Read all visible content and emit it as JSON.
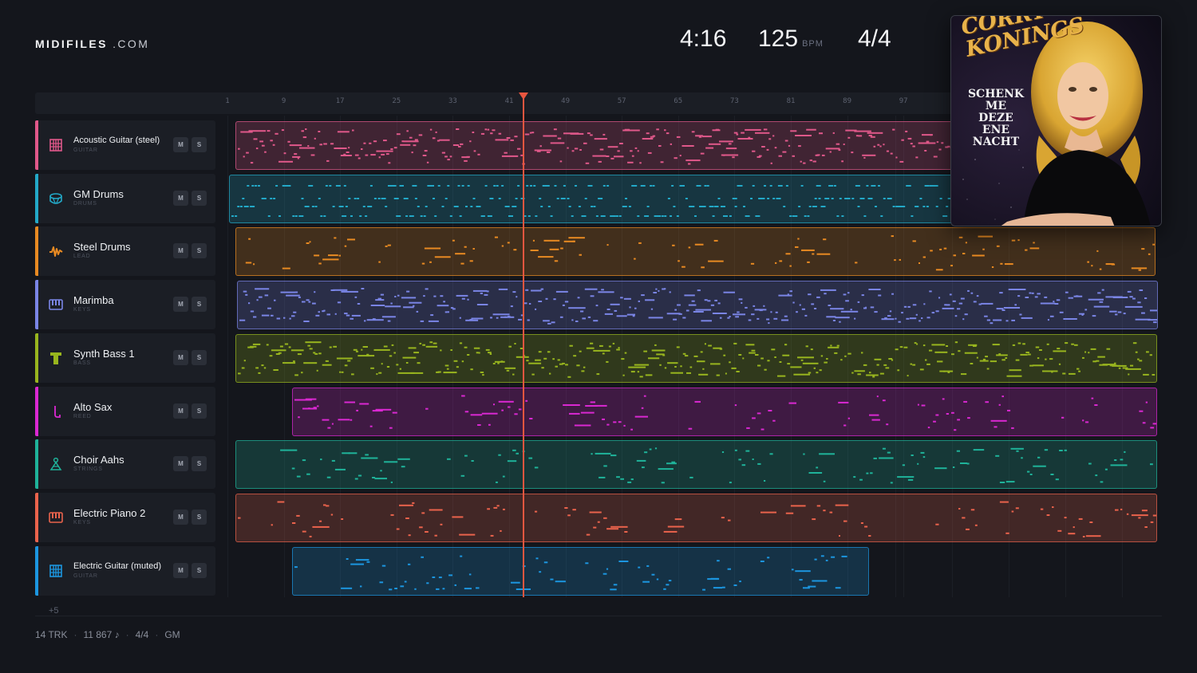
{
  "brand": {
    "name_bold": "MIDIFILES",
    "name_suffix": ".COM"
  },
  "stats": {
    "duration": "4:16",
    "tempo": "125",
    "tempo_unit": "BPM",
    "time_signature": "4/4"
  },
  "ruler": {
    "bars": [
      "1",
      "9",
      "17",
      "25",
      "33",
      "41",
      "49",
      "57",
      "65",
      "73",
      "81",
      "89",
      "97"
    ]
  },
  "playhead": {
    "bar": "41"
  },
  "album": {
    "artist_line1": "CORRY",
    "artist_line2": "KONINGS",
    "title_line1": "SCHENK ME",
    "title_line2": "DEZE",
    "title_line3": "ENE NACHT"
  },
  "tracks": [
    {
      "name": "Acoustic Guitar (steel)",
      "category": "GUITAR",
      "color": "#e0588a",
      "icon": "guitar-icon",
      "mute": "M",
      "solo": "S"
    },
    {
      "name": "GM Drums",
      "category": "DRUMS",
      "color": "#23a9c8",
      "icon": "drum-icon",
      "mute": "M",
      "solo": "S"
    },
    {
      "name": "Steel Drums",
      "category": "LEAD",
      "color": "#e88a22",
      "icon": "wave-icon",
      "mute": "M",
      "solo": "S"
    },
    {
      "name": "Marimba",
      "category": "KEYS",
      "color": "#7a85e6",
      "icon": "keys-icon",
      "mute": "M",
      "solo": "S"
    },
    {
      "name": "Synth Bass 1",
      "category": "BASS",
      "color": "#98b51e",
      "icon": "bass-icon",
      "mute": "M",
      "solo": "S"
    },
    {
      "name": "Alto Sax",
      "category": "REED",
      "color": "#da28d2",
      "icon": "sax-icon",
      "mute": "M",
      "solo": "S"
    },
    {
      "name": "Choir Aahs",
      "category": "STRINGS",
      "color": "#1fb39a",
      "icon": "choir-icon",
      "mute": "M",
      "solo": "S"
    },
    {
      "name": "Electric Piano 2",
      "category": "KEYS",
      "color": "#ea634c",
      "icon": "keys-icon",
      "mute": "M",
      "solo": "S"
    },
    {
      "name": "Electric Guitar (muted)",
      "category": "GUITAR",
      "color": "#1c96e0",
      "icon": "guitar-icon",
      "mute": "M",
      "solo": "S"
    }
  ],
  "more_tracks": "+5",
  "footer": {
    "tracks": "14 TRK",
    "notes": "11 867 ♪",
    "meter": "4/4",
    "standard": "GM"
  }
}
